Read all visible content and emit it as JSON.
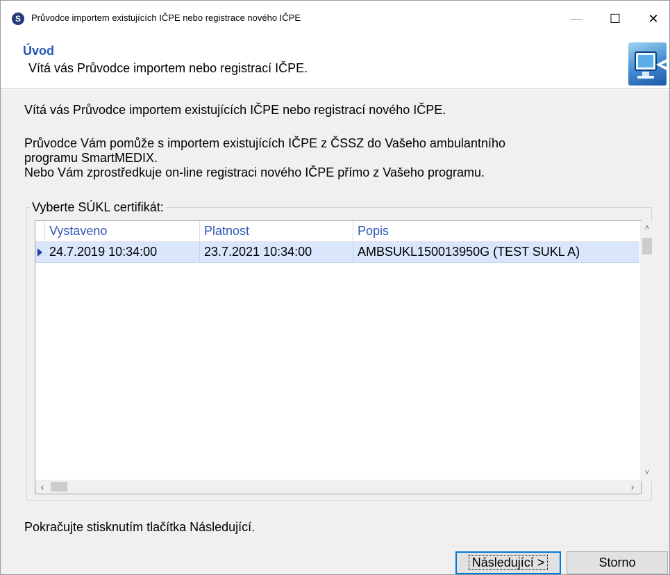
{
  "window": {
    "title": "Průvodce importem existujících IČPE nebo registrace nového IČPE",
    "app_icon_letter": "S",
    "minimize_glyph": "—",
    "maximize_glyph": "☐",
    "close_glyph": "✕"
  },
  "header": {
    "title": "Úvod",
    "subtitle": "Vítá vás Průvodce importem nebo registrací IČPE.",
    "logo_icon": "computer-arrow-icon"
  },
  "body": {
    "welcome": "Vítá vás Průvodce importem existujících IČPE nebo registrací nového IČPE.",
    "para1_line1": "Průvodce Vám pomůže s importem existujících IČPE z ČSSZ do Vašeho ambulantního",
    "para1_line2": "programu SmartMEDIX.",
    "para2": "Nebo Vám zprostředkuje on-line registraci nového IČPE přímo z Vašeho programu.",
    "group_label": "Vyberte SÚKL certifikát:",
    "footer_hint": "Pokračujte stisknutím tlačítka Následující."
  },
  "grid": {
    "columns": [
      "Vystaveno",
      "Platnost",
      "Popis"
    ],
    "rows": [
      [
        "24.7.2019 10:34:00",
        "23.7.2021 10:34:00",
        "AMBSUKL150013950G (TEST SUKL A)"
      ]
    ],
    "selected_row": 0,
    "scroll_up": "˄",
    "scroll_down": "˅",
    "scroll_left": "‹",
    "scroll_right": "›"
  },
  "buttons": {
    "next": "Následující >",
    "cancel": "Storno"
  },
  "colors": {
    "header_title": "#2257b4",
    "column_header": "#2e56b5",
    "selected_row": "#d9e6fb",
    "default_button_border": "#0078d7"
  }
}
